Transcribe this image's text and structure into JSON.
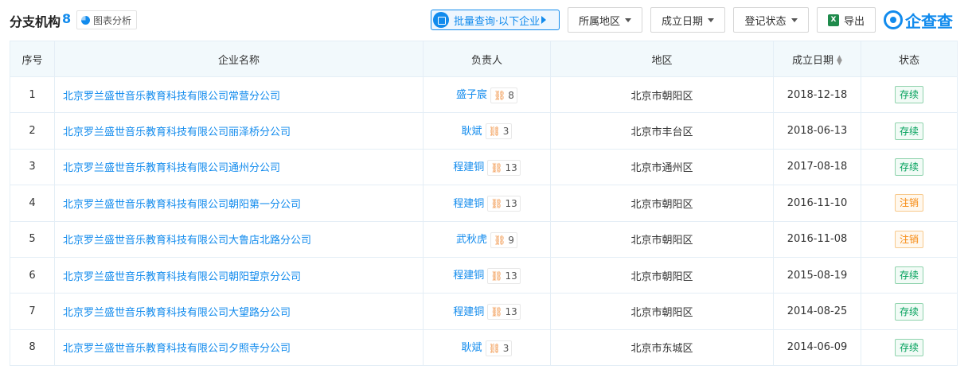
{
  "header": {
    "title": "分支机构",
    "count": "8",
    "chart_label": "图表分析",
    "batch_query_label": "批量查询·以下企业",
    "filters": [
      "所属地区",
      "成立日期",
      "登记状态"
    ],
    "export_label": "导出",
    "logo_text": "企查查"
  },
  "colors": {
    "accent": "#128bed",
    "status_active": "#00a05a",
    "status_cancelled": "#f6890f"
  },
  "table": {
    "columns": [
      "序号",
      "企业名称",
      "负责人",
      "地区",
      "成立日期",
      "状态"
    ],
    "rows": [
      {
        "no": "1",
        "name": "北京罗兰盛世音乐教育科技有限公司常营分公司",
        "person": "盛子宸",
        "rel": "8",
        "region": "北京市朝阳区",
        "date": "2018-12-18",
        "status": "存续"
      },
      {
        "no": "2",
        "name": "北京罗兰盛世音乐教育科技有限公司丽泽桥分公司",
        "person": "耿斌",
        "rel": "3",
        "region": "北京市丰台区",
        "date": "2018-06-13",
        "status": "存续"
      },
      {
        "no": "3",
        "name": "北京罗兰盛世音乐教育科技有限公司通州分公司",
        "person": "程建铜",
        "rel": "13",
        "region": "北京市通州区",
        "date": "2017-08-18",
        "status": "存续"
      },
      {
        "no": "4",
        "name": "北京罗兰盛世音乐教育科技有限公司朝阳第一分公司",
        "person": "程建铜",
        "rel": "13",
        "region": "北京市朝阳区",
        "date": "2016-11-10",
        "status": "注销"
      },
      {
        "no": "5",
        "name": "北京罗兰盛世音乐教育科技有限公司大鲁店北路分公司",
        "person": "武秋虎",
        "rel": "9",
        "region": "北京市朝阳区",
        "date": "2016-11-08",
        "status": "注销"
      },
      {
        "no": "6",
        "name": "北京罗兰盛世音乐教育科技有限公司朝阳望京分公司",
        "person": "程建铜",
        "rel": "13",
        "region": "北京市朝阳区",
        "date": "2015-08-19",
        "status": "存续"
      },
      {
        "no": "7",
        "name": "北京罗兰盛世音乐教育科技有限公司大望路分公司",
        "person": "程建铜",
        "rel": "13",
        "region": "北京市朝阳区",
        "date": "2014-08-25",
        "status": "存续"
      },
      {
        "no": "8",
        "name": "北京罗兰盛世音乐教育科技有限公司夕照寺分公司",
        "person": "耿斌",
        "rel": "3",
        "region": "北京市东城区",
        "date": "2014-06-09",
        "status": "存续"
      }
    ]
  }
}
